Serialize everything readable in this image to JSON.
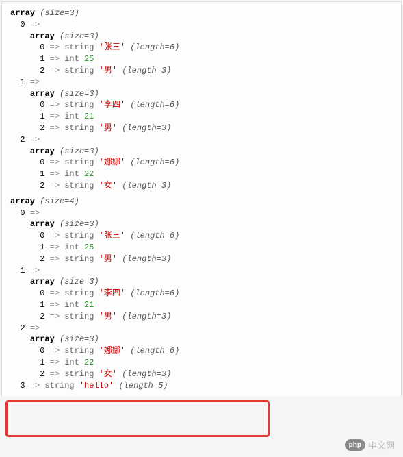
{
  "dump1": {
    "header": "array",
    "size": "(size=3)",
    "items": [
      {
        "index": "0",
        "header": "array",
        "size": "(size=3)",
        "children": [
          {
            "index": "0",
            "type": "string",
            "value": "'张三'",
            "length": "(length=6)"
          },
          {
            "index": "1",
            "type": "int",
            "value": "25",
            "length": ""
          },
          {
            "index": "2",
            "type": "string",
            "value": "'男'",
            "length": "(length=3)"
          }
        ]
      },
      {
        "index": "1",
        "header": "array",
        "size": "(size=3)",
        "children": [
          {
            "index": "0",
            "type": "string",
            "value": "'李四'",
            "length": "(length=6)"
          },
          {
            "index": "1",
            "type": "int",
            "value": "21",
            "length": ""
          },
          {
            "index": "2",
            "type": "string",
            "value": "'男'",
            "length": "(length=3)"
          }
        ]
      },
      {
        "index": "2",
        "header": "array",
        "size": "(size=3)",
        "children": [
          {
            "index": "0",
            "type": "string",
            "value": "'娜娜'",
            "length": "(length=6)"
          },
          {
            "index": "1",
            "type": "int",
            "value": "22",
            "length": ""
          },
          {
            "index": "2",
            "type": "string",
            "value": "'女'",
            "length": "(length=3)"
          }
        ]
      }
    ]
  },
  "dump2": {
    "header": "array",
    "size": "(size=4)",
    "items": [
      {
        "index": "0",
        "header": "array",
        "size": "(size=3)",
        "children": [
          {
            "index": "0",
            "type": "string",
            "value": "'张三'",
            "length": "(length=6)"
          },
          {
            "index": "1",
            "type": "int",
            "value": "25",
            "length": ""
          },
          {
            "index": "2",
            "type": "string",
            "value": "'男'",
            "length": "(length=3)"
          }
        ]
      },
      {
        "index": "1",
        "header": "array",
        "size": "(size=3)",
        "children": [
          {
            "index": "0",
            "type": "string",
            "value": "'李四'",
            "length": "(length=6)"
          },
          {
            "index": "1",
            "type": "int",
            "value": "21",
            "length": ""
          },
          {
            "index": "2",
            "type": "string",
            "value": "'男'",
            "length": "(length=3)"
          }
        ]
      },
      {
        "index": "2",
        "header": "array",
        "size": "(size=3)",
        "children": [
          {
            "index": "0",
            "type": "string",
            "value": "'娜娜'",
            "length": "(length=6)"
          },
          {
            "index": "1",
            "type": "int",
            "value": "22",
            "length": ""
          },
          {
            "index": "2",
            "type": "string",
            "value": "'女'",
            "length": "(length=3)"
          }
        ]
      }
    ],
    "extra": {
      "index": "3",
      "type": "string",
      "value": "'hello'",
      "length": "(length=5)"
    }
  },
  "watermark": {
    "logo": "php",
    "text": "中文网"
  }
}
